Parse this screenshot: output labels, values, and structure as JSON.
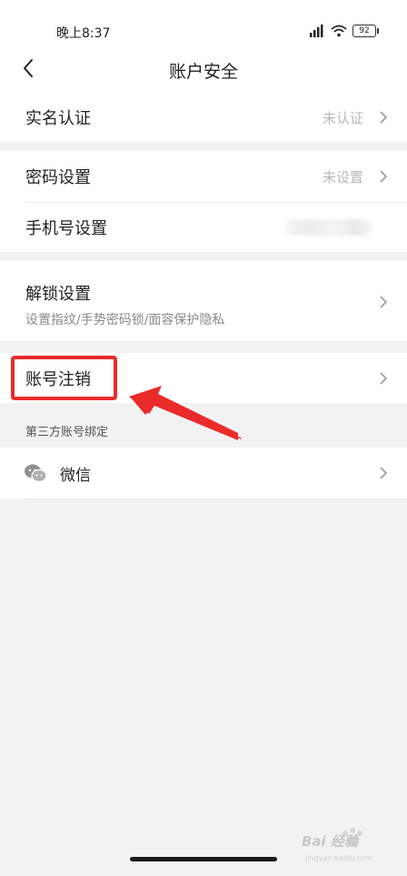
{
  "status_bar": {
    "time": "晚上8:37",
    "battery": "92"
  },
  "nav": {
    "title": "账户安全"
  },
  "rows": {
    "real_name": {
      "label": "实名认证",
      "value": "未认证"
    },
    "password": {
      "label": "密码设置",
      "value": "未设置"
    },
    "phone": {
      "label": "手机号设置"
    },
    "unlock": {
      "label": "解锁设置",
      "sub": "设置指纹/手势密码锁/面容保护隐私"
    },
    "deactivate": {
      "label": "账号注销"
    }
  },
  "third_party": {
    "header": "第三方账号绑定",
    "items": [
      {
        "label": "微信",
        "icon": "wechat-icon"
      }
    ]
  },
  "watermark": {
    "text": "Bai 经验",
    "url": "jingyan.baidu.com"
  },
  "colors": {
    "highlight": "#ea2b2b",
    "chevron": "#9a9a9a",
    "value": "#b8b8b8"
  }
}
